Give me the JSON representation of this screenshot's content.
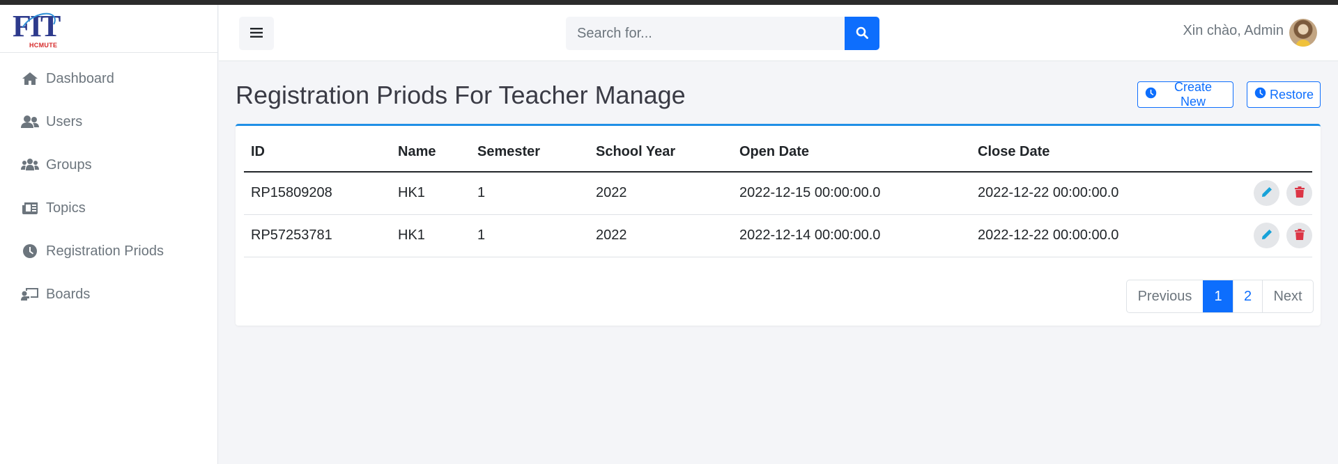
{
  "logo": {
    "text": "FIT",
    "sub": "HCMUTE"
  },
  "sidebar": {
    "items": [
      {
        "label": "Dashboard",
        "icon": "home-icon"
      },
      {
        "label": "Users",
        "icon": "users-icon"
      },
      {
        "label": "Groups",
        "icon": "group-icon"
      },
      {
        "label": "Topics",
        "icon": "newspaper-icon"
      },
      {
        "label": "Registration Priods",
        "icon": "clock-icon"
      },
      {
        "label": "Boards",
        "icon": "chalkboard-teacher-icon"
      }
    ]
  },
  "header": {
    "search_placeholder": "Search for...",
    "greeting": "Xin chào, Admin"
  },
  "page": {
    "title": "Registration Priods For Teacher Manage",
    "create_label": "Create New",
    "restore_label": "Restore"
  },
  "table": {
    "columns": [
      "ID",
      "Name",
      "Semester",
      "School Year",
      "Open Date",
      "Close Date"
    ],
    "rows": [
      {
        "id": "RP15809208",
        "name": "HK1",
        "semester": "1",
        "school_year": "2022",
        "open_date": "2022-12-15 00:00:00.0",
        "close_date": "2022-12-22 00:00:00.0"
      },
      {
        "id": "RP57253781",
        "name": "HK1",
        "semester": "1",
        "school_year": "2022",
        "open_date": "2022-12-14 00:00:00.0",
        "close_date": "2022-12-22 00:00:00.0"
      }
    ]
  },
  "pagination": {
    "previous": "Previous",
    "pages": [
      "1",
      "2"
    ],
    "current": "1",
    "next": "Next"
  },
  "colors": {
    "primary": "#0d6efd",
    "edit": "#17a2d8",
    "delete": "#dc3545",
    "card_accent": "#1f8fe6"
  }
}
